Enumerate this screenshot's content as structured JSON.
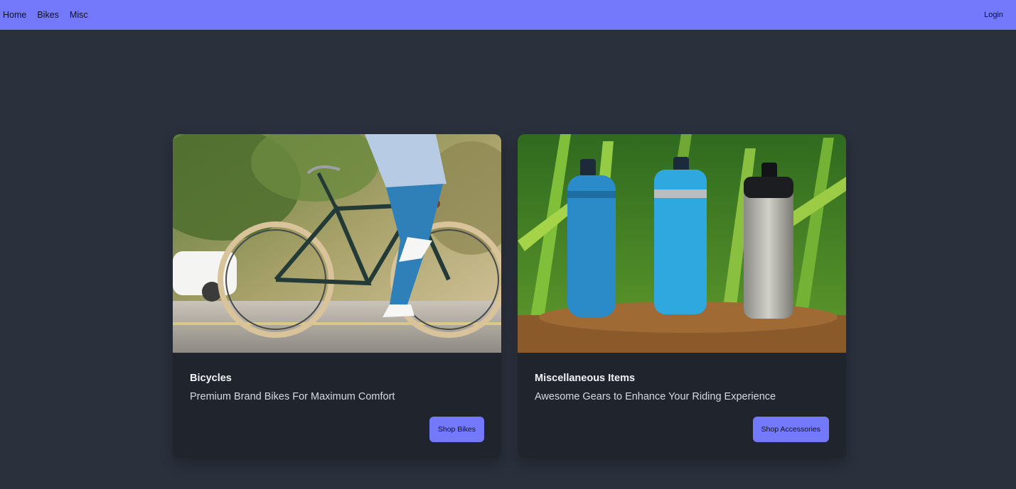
{
  "nav": {
    "links": [
      "Home",
      "Bikes",
      "Misc"
    ],
    "login_label": "Login"
  },
  "cards": [
    {
      "title": "Bicycles",
      "description": "Premium Brand Bikes For Maximum Comfort",
      "button_label": "Shop Bikes"
    },
    {
      "title": "Miscellaneous Items",
      "description": "Awesome Gears to Enhance Your Riding Experience",
      "button_label": "Shop Accessories"
    }
  ],
  "colors": {
    "accent": "#7479fb",
    "page_bg": "#2a303c",
    "card_bg": "#1f242d"
  }
}
